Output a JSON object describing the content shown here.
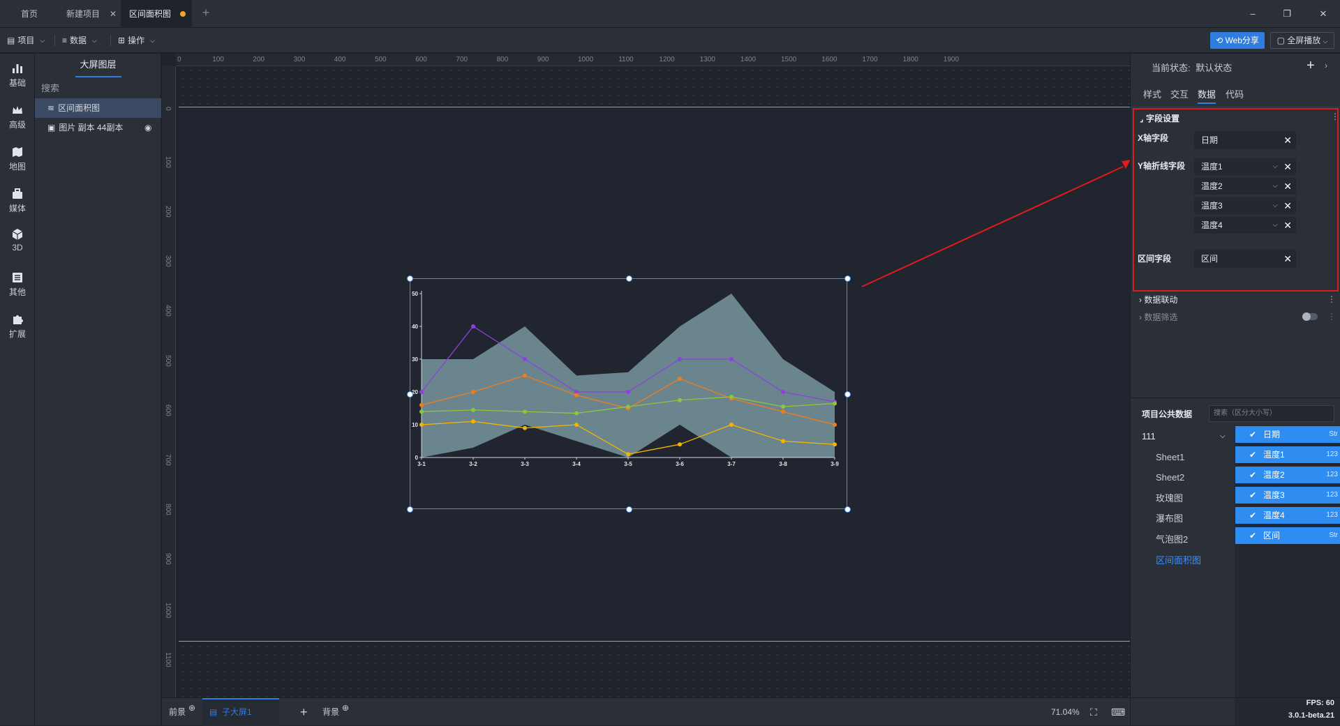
{
  "tabs": [
    {
      "label": "首页"
    },
    {
      "label": "新建项目"
    },
    {
      "label": "区间面积图"
    }
  ],
  "toolbar": {
    "project": "项目",
    "data": "数据",
    "operate": "操作",
    "web_share": "Web分享",
    "fullscreen": "全屏播放"
  },
  "sidebar": {
    "items": [
      {
        "label": "基础",
        "icon": "bar-chart-icon"
      },
      {
        "label": "高级",
        "icon": "crown-icon"
      },
      {
        "label": "地图",
        "icon": "map-icon"
      },
      {
        "label": "媒体",
        "icon": "briefcase-icon"
      },
      {
        "label": "3D",
        "icon": "cube-icon"
      },
      {
        "label": "其他",
        "icon": "list-icon"
      },
      {
        "label": "扩展",
        "icon": "puzzle-icon"
      }
    ]
  },
  "layers": {
    "header": "大屏图层",
    "search_placeholder": "搜索",
    "items": [
      {
        "label": "区间面积图"
      },
      {
        "label": "图片 副本 44副本"
      }
    ]
  },
  "rulers": {
    "top": [
      "0",
      "100",
      "200",
      "300",
      "400",
      "500",
      "600",
      "700",
      "800",
      "900",
      "1000",
      "1100",
      "1200",
      "1300",
      "1400",
      "1500",
      "1600",
      "1700",
      "1800",
      "1900"
    ],
    "left": [
      "0",
      "100",
      "200",
      "300",
      "400",
      "500",
      "600",
      "700",
      "800",
      "900",
      "1000",
      "1100"
    ]
  },
  "bottom": {
    "foreground": "前景",
    "subscreen": "子大屏1",
    "background": "背景",
    "zoom": "71.04%"
  },
  "status": {
    "fps": "FPS: 60",
    "version": "3.0.1-beta.21"
  },
  "right_panel": {
    "state_label": "当前状态:",
    "state_value": "默认状态",
    "tabs": [
      "样式",
      "交互",
      "数据",
      "代码"
    ],
    "field_settings": {
      "title": "字段设置",
      "x_label": "X轴字段",
      "x_value": "日期",
      "y_label": "Y轴折线字段",
      "y_values": [
        "温度1",
        "温度2",
        "温度3",
        "温度4"
      ],
      "range_label": "区间字段",
      "range_value": "区间"
    },
    "data_link": "数据联动",
    "data_filter": "数据筛选",
    "public_data": {
      "title": "项目公共数据",
      "search_placeholder": "搜索（区分大小写）",
      "group": "111",
      "tree": [
        "Sheet1",
        "Sheet2",
        "玫瑰图",
        "瀑布图",
        "气泡图2",
        "区间面积图"
      ],
      "columns": [
        {
          "name": "日期",
          "type": "Str"
        },
        {
          "name": "温度1",
          "type": "123"
        },
        {
          "name": "温度2",
          "type": "123"
        },
        {
          "name": "温度3",
          "type": "123"
        },
        {
          "name": "温度4",
          "type": "123"
        },
        {
          "name": "区间",
          "type": "Str"
        }
      ]
    }
  },
  "colors": {
    "accent": "#2f7de1",
    "highlight_box": "#e01b1b",
    "area_fill": "#6f8a93"
  },
  "chart_data": {
    "type": "line",
    "categories": [
      "3-1",
      "3-2",
      "3-3",
      "3-4",
      "3-5",
      "3-6",
      "3-7",
      "3-8",
      "3-9"
    ],
    "yticks": [
      "0",
      "10",
      "20",
      "30",
      "40",
      "50"
    ],
    "ylim": [
      0,
      50
    ],
    "range": {
      "low": [
        0,
        3,
        10,
        5,
        0,
        10,
        0,
        0,
        0
      ],
      "high": [
        30,
        30,
        40,
        25,
        26,
        40,
        50,
        30,
        20
      ]
    },
    "series": [
      {
        "values": [
          20,
          40,
          30,
          20,
          20,
          30,
          30,
          20,
          17
        ],
        "color": "#8f3fe0"
      },
      {
        "values": [
          16,
          20,
          25,
          19,
          15,
          24,
          18,
          14,
          10
        ],
        "color": "#f07d1a"
      },
      {
        "values": [
          14,
          14.5,
          14,
          13.5,
          15.5,
          17.5,
          18.5,
          15.5,
          16.5
        ],
        "color": "#8cc63f"
      },
      {
        "values": [
          10,
          11,
          9,
          10,
          1,
          4,
          10,
          5,
          4
        ],
        "color": "#f5b400"
      }
    ]
  }
}
